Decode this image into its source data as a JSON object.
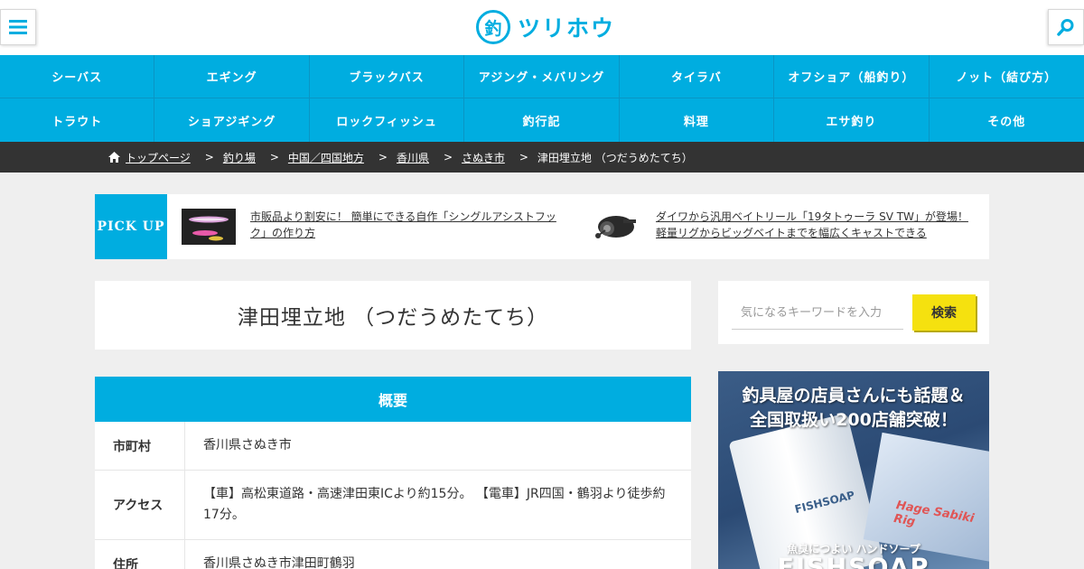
{
  "header": {
    "logo_mark": "釣",
    "logo_text": "ツリホウ"
  },
  "categories": [
    "シーバス",
    "エギング",
    "ブラックバス",
    "アジング・メバリング",
    "タイラバ",
    "オフショア（船釣り）",
    "ノット（結び方）",
    "トラウト",
    "ショアジギング",
    "ロックフィッシュ",
    "釣行記",
    "料理",
    "エサ釣り",
    "その他"
  ],
  "breadcrumb": {
    "home": "トップページ",
    "items": [
      "釣り場",
      "中国／四国地方",
      "香川県",
      "さぬき市"
    ],
    "current": "津田埋立地 （つだうめたてち）",
    "separator": ">"
  },
  "pickup": {
    "label": "PICK UP",
    "items": [
      "市販品より割安に！ 簡単にできる自作「シングルアシストフック」の作り方",
      "ダイワから汎用ベイトリール「19タトゥーラ SV TW」が登場！軽量リグからビッグベイトまでを幅広くキャストできる"
    ]
  },
  "article": {
    "title": "津田埋立地 （つだうめたてち）"
  },
  "overview": {
    "heading": "概要",
    "rows": [
      {
        "key": "市町村",
        "value": "香川県さぬき市"
      },
      {
        "key": "アクセス",
        "value": "【車】高松東道路・高速津田東ICより約15分。 【電車】JR四国・鶴羽より徒歩約17分。"
      },
      {
        "key": "住所",
        "value": "香川県さぬき市津田町鶴羽"
      }
    ]
  },
  "sidebar": {
    "search_placeholder": "気になるキーワードを入力",
    "search_button": "検索"
  },
  "ad": {
    "headline_1": "釣具屋の店員さんにも話題＆",
    "headline_2": "全国取扱い200店舗突破！",
    "tube_label": "FISHSOAP",
    "box_label": "Hage Sabiki Rig",
    "sub": "魚臭につよい ハンドソープ",
    "brand": "FISHSOAP"
  },
  "colors": {
    "accent": "#00ade0",
    "breadcrumb_bg": "#333333",
    "search_button": "#f5e10f"
  }
}
